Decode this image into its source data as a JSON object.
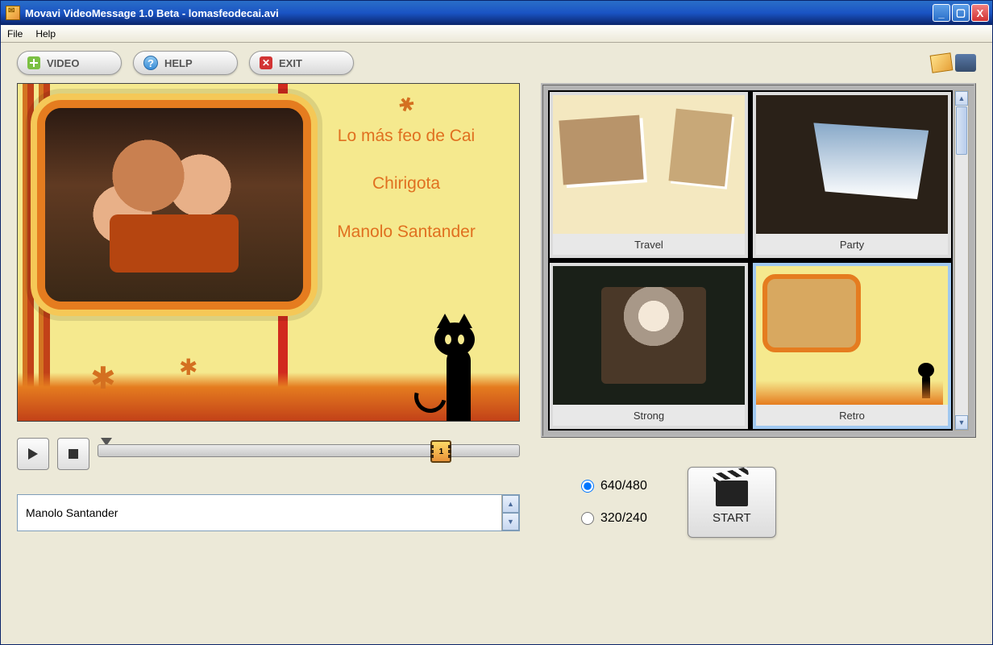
{
  "window": {
    "title": "Movavi VideoMessage 1.0 Beta - lomasfeodecai.avi"
  },
  "menubar": {
    "file": "File",
    "help": "Help"
  },
  "toolbar": {
    "video": "VIDEO",
    "help": "HELP",
    "exit": "EXIT"
  },
  "preview": {
    "line1": "Lo más feo de Cai",
    "line2": "Chirigota",
    "line3": "Manolo Santander"
  },
  "playback": {
    "frame_number": "1"
  },
  "text_input": {
    "value": "Manolo Santander"
  },
  "templates": [
    {
      "label": "Travel"
    },
    {
      "label": "Party"
    },
    {
      "label": "Strong"
    },
    {
      "label": "Retro"
    }
  ],
  "resolutions": {
    "opt1": "640/480",
    "opt2": "320/240",
    "selected": "640/480"
  },
  "start_button": "START"
}
